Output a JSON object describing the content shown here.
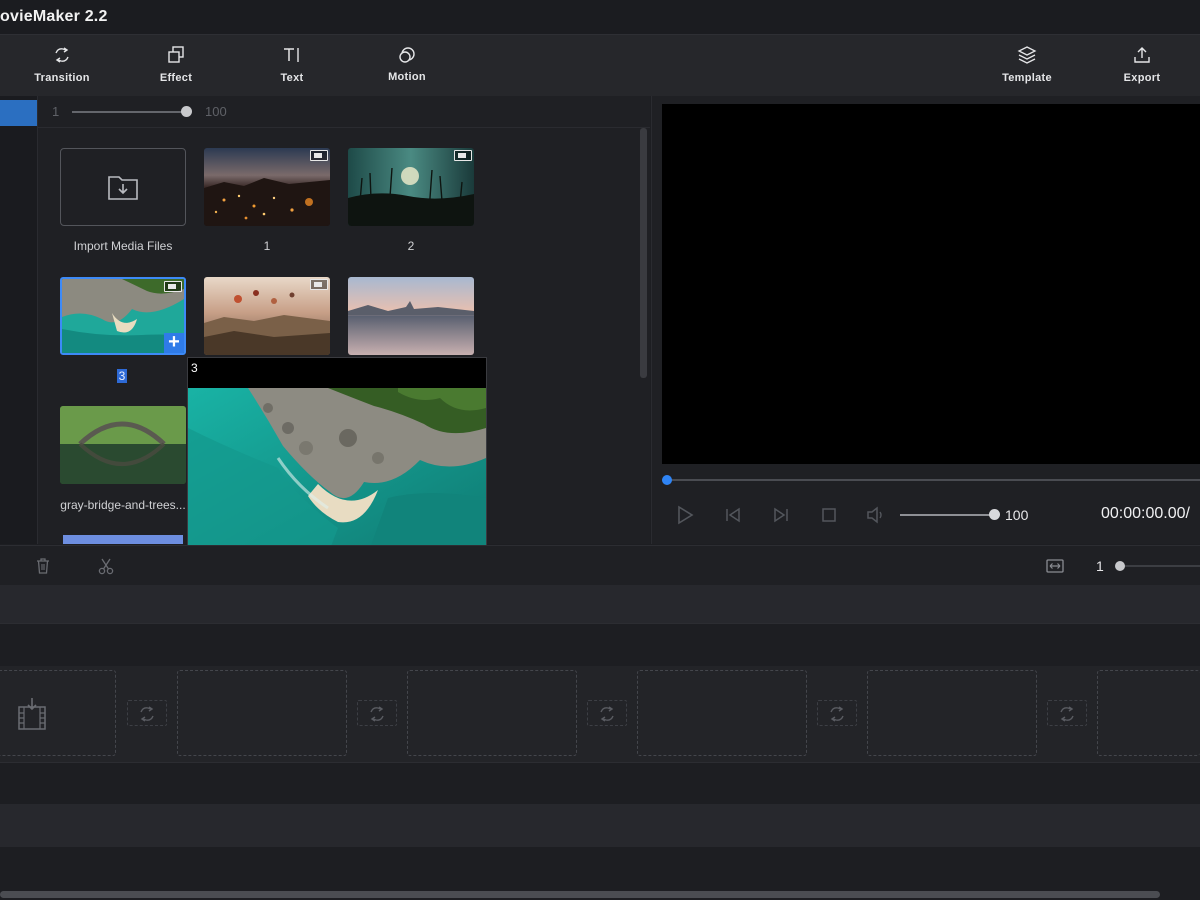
{
  "app": {
    "title": "ovieMaker 2.2"
  },
  "toolbar": {
    "transition": {
      "label": "Transition",
      "icon": "transition-icon"
    },
    "effect": {
      "label": "Effect",
      "icon": "effect-icon"
    },
    "text": {
      "label": "Text",
      "icon": "text-icon"
    },
    "motion": {
      "label": "Motion",
      "icon": "motion-icon"
    },
    "template": {
      "label": "Template",
      "icon": "layers-icon"
    },
    "export": {
      "label": "Export",
      "icon": "upload-icon"
    }
  },
  "media": {
    "zoom_min": "1",
    "zoom_max": "100",
    "import_label": "Import Media Files",
    "items": [
      {
        "label": "1",
        "type": "video",
        "scene": "night city"
      },
      {
        "label": "2",
        "type": "video",
        "scene": "reeds at sunset"
      },
      {
        "label": "3",
        "type": "video",
        "scene": "aerial beach",
        "selected": true
      },
      {
        "label": "",
        "type": "video",
        "scene": "hot air balloons"
      },
      {
        "label": "",
        "type": "image",
        "scene": "lake reflection"
      },
      {
        "label": "gray-bridge-and-trees...",
        "type": "image",
        "scene": "stone bridge"
      }
    ],
    "hover_preview": {
      "title": "3"
    }
  },
  "player": {
    "volume": "100",
    "timecode": "00:00:00.00/",
    "progress": 0
  },
  "timeline": {
    "zoom_value": "1",
    "colors": {
      "accent": "#2f84f5",
      "selection": "#3d8af7"
    }
  }
}
